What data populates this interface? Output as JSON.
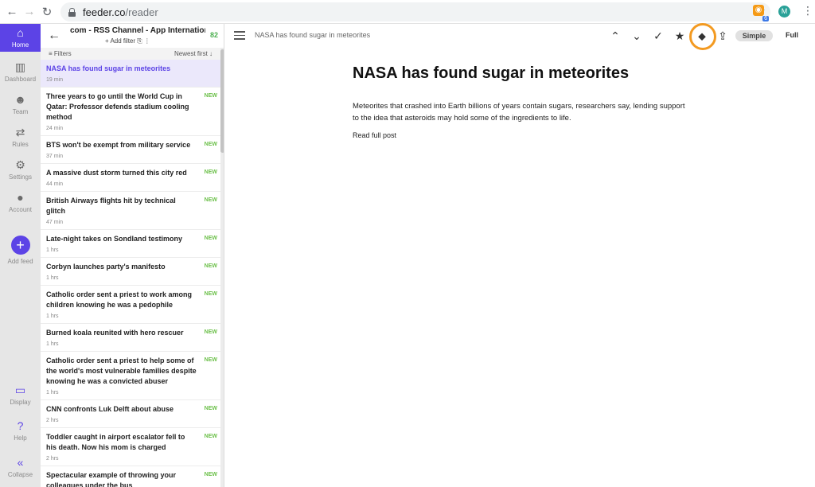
{
  "browser": {
    "url_host": "feeder.co",
    "url_path": "/reader",
    "rss_badge": "6",
    "avatar_initial": "M"
  },
  "rail": {
    "items": [
      {
        "label": "Home",
        "icon": "home-icon"
      },
      {
        "label": "Dashboard",
        "icon": "dashboard-icon"
      },
      {
        "label": "Team",
        "icon": "team-icon"
      },
      {
        "label": "Rules",
        "icon": "rules-icon"
      },
      {
        "label": "Settings",
        "icon": "gear-icon"
      },
      {
        "label": "Account",
        "icon": "account-icon"
      },
      {
        "label": "Add feed",
        "icon": "plus-icon"
      },
      {
        "label": "Display",
        "icon": "display-icon"
      },
      {
        "label": "Help",
        "icon": "help-icon"
      },
      {
        "label": "Collapse",
        "icon": "collapse-icon"
      }
    ],
    "accent": "#5c43e6"
  },
  "feed": {
    "title": "com - RSS Channel - App Internationa",
    "count": "82",
    "add_filter": "Add filter",
    "filters_label": "Filters",
    "sort_label": "Newest first"
  },
  "articles": [
    {
      "title": "NASA has found sugar in meteorites",
      "time": "19 min",
      "new": ""
    },
    {
      "title": "Three years to go until the World Cup in Qatar: Professor defends stadium cooling method",
      "time": "24 min",
      "new": "NEW"
    },
    {
      "title": "BTS won't be exempt from military service",
      "time": "37 min",
      "new": "NEW"
    },
    {
      "title": "A massive dust storm turned this city red",
      "time": "44 min",
      "new": "NEW"
    },
    {
      "title": "British Airways flights hit by technical glitch",
      "time": "47 min",
      "new": "NEW"
    },
    {
      "title": "Late-night takes on Sondland testimony",
      "time": "1 hrs",
      "new": "NEW"
    },
    {
      "title": "Corbyn launches party's manifesto",
      "time": "1 hrs",
      "new": "NEW"
    },
    {
      "title": "Catholic order sent a priest to work among children knowing he was a pedophile",
      "time": "1 hrs",
      "new": "NEW"
    },
    {
      "title": "Burned koala reunited with hero rescuer",
      "time": "1 hrs",
      "new": "NEW"
    },
    {
      "title": "Catholic order sent a priest to help some of the world's most vulnerable families despite knowing he was a convicted abuser",
      "time": "1 hrs",
      "new": "NEW"
    },
    {
      "title": "CNN confronts Luk Delft about abuse",
      "time": "2 hrs",
      "new": "NEW"
    },
    {
      "title": "Toddler caught in airport escalator fell to his death. Now his mom is charged",
      "time": "2 hrs",
      "new": "NEW"
    },
    {
      "title": "Spectacular example of throwing your colleagues under the bus",
      "time": "",
      "new": "NEW"
    }
  ],
  "reader": {
    "breadcrumb": "NASA has found sugar in meteorites",
    "simple_label": "Simple",
    "full_label": "Full",
    "highlight_color": "#f39a21",
    "article_title": "NASA has found sugar in meteorites",
    "article_body": "Meteorites that crashed into Earth billions of years contain sugars, researchers say, lending support to the idea that asteroids may hold some of the ingredients to life.",
    "read_full": "Read full post"
  }
}
